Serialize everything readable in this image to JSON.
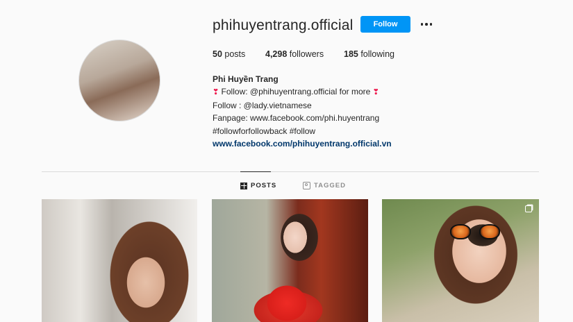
{
  "profile": {
    "username": "phihuyentrang.official",
    "follow_label": "Follow",
    "more_icon": "more-options-icon"
  },
  "stats": {
    "posts_count": "50",
    "posts_label": " posts",
    "followers_count": "4,298",
    "followers_label": " followers",
    "following_count": "185",
    "following_label": " following"
  },
  "bio": {
    "full_name": "Phi Huyền Trang",
    "line1_heart": "❣",
    "line1": " Follow: @phihuyentrang.official for more",
    "line2": "Follow : @lady.vietnamese",
    "line3": "Fanpage: www.facebook.com/phi.huyentrang",
    "line4": "#followforfollowback #follow",
    "link": "www.facebook.com/phihuyentrang.official.vn"
  },
  "tabs": [
    {
      "label": "POSTS",
      "icon": "grid-icon",
      "active": true
    },
    {
      "label": "TAGGED",
      "icon": "tag-icon",
      "active": false
    }
  ],
  "posts": [
    {
      "id": "post-1",
      "multi": false
    },
    {
      "id": "post-2",
      "multi": false
    },
    {
      "id": "post-3",
      "multi": true
    }
  ],
  "colors": {
    "accent": "#0095f6",
    "background": "#fafafa",
    "text": "#262626",
    "secondary_text": "#8e8e8e",
    "link": "#00376b",
    "heart": "#ed1c4f"
  }
}
